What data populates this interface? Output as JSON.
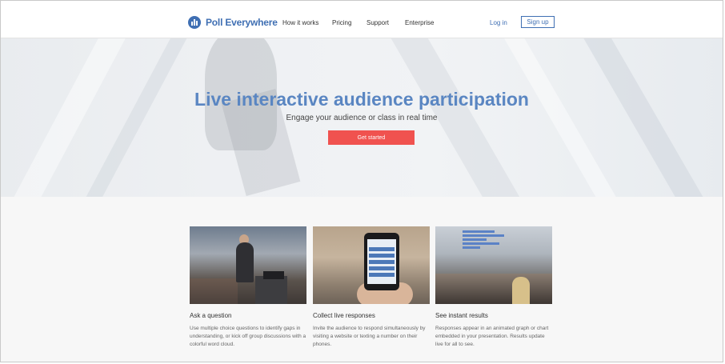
{
  "brand": {
    "name": "Poll Everywhere",
    "color": "#3f6fb3",
    "icon": "poll-logo-icon"
  },
  "nav": {
    "links": [
      {
        "label": "How it works"
      },
      {
        "label": "Pricing"
      },
      {
        "label": "Support"
      },
      {
        "label": "Enterprise"
      }
    ],
    "login": "Log in",
    "signup": "Sign up"
  },
  "hero": {
    "title": "Live interactive audience participation",
    "subtitle": "Engage your audience or class in real time",
    "cta": "Get started",
    "title_color": "#5a86c2",
    "cta_color": "#f0524f"
  },
  "features": [
    {
      "title": "Ask a question",
      "text": "Use multiple choice questions to identify gaps in understanding, or kick off group discussions with a colorful word cloud."
    },
    {
      "title": "Collect live responses",
      "text": "Invite the audience to respond simultaneously by visiting a website or texting a number on their phones."
    },
    {
      "title": "See instant results",
      "text": "Responses appear in an animated graph or chart embedded in your presentation. Results update live for all to see."
    }
  ]
}
